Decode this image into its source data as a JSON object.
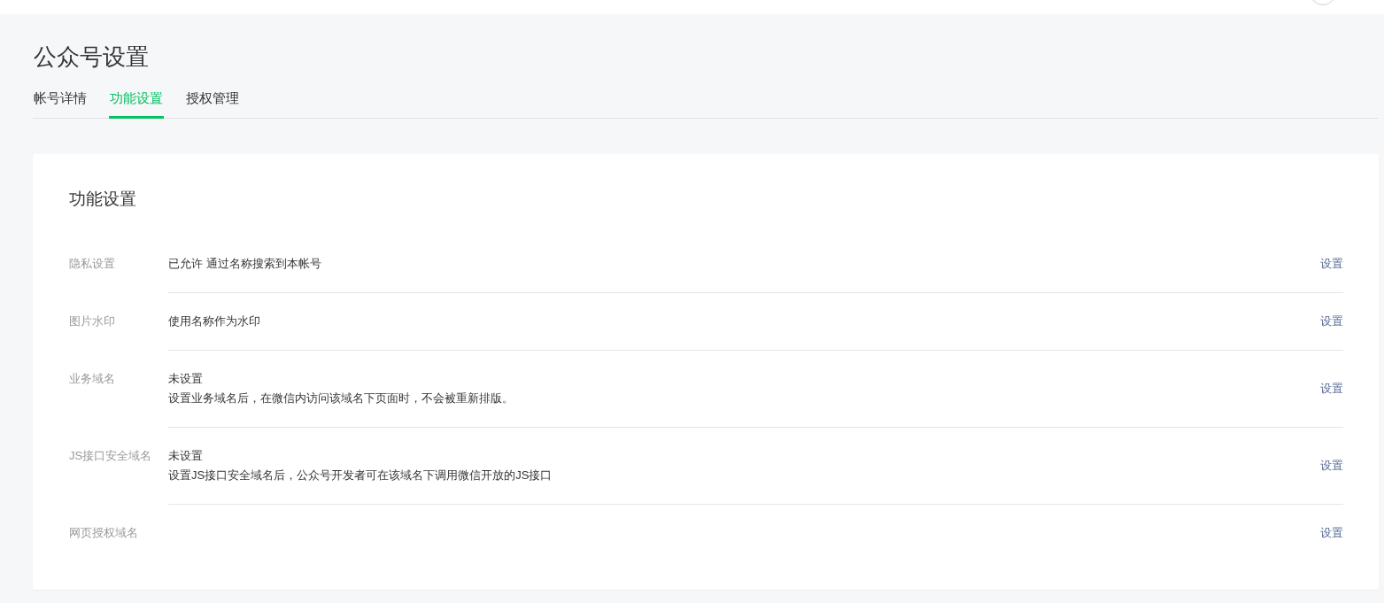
{
  "page_title": "公众号设置",
  "tabs": [
    {
      "label": "帐号详情",
      "selected": false
    },
    {
      "label": "功能设置",
      "selected": true
    },
    {
      "label": "授权管理",
      "selected": false
    }
  ],
  "card": {
    "title": "功能设置",
    "rows": [
      {
        "label": "隐私设置",
        "value": "已允许 通过名称搜索到本帐号",
        "action": "设置"
      },
      {
        "label": "图片水印",
        "value": "使用名称作为水印",
        "action": "设置"
      },
      {
        "label": "业务域名",
        "value": "未设置",
        "description": "设置业务域名后，在微信内访问该域名下页面时，不会被重新排版。",
        "action": "设置"
      },
      {
        "label": "JS接口安全域名",
        "value": "未设置",
        "description": "设置JS接口安全域名后，公众号开发者可在该域名下调用微信开放的JS接口",
        "action": "设置"
      },
      {
        "label": "网页授权域名",
        "action": "设置"
      }
    ]
  }
}
